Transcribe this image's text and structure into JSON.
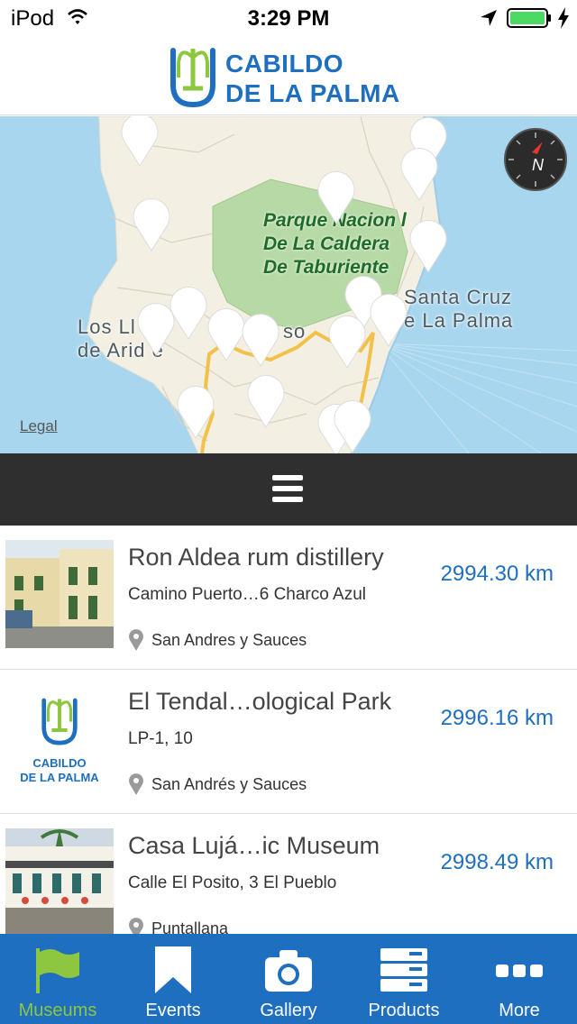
{
  "status_bar": {
    "carrier": "iPod",
    "time": "3:29 PM"
  },
  "header": {
    "brand_line1": "CABILDO",
    "brand_line2": "DE LA PALMA",
    "brand_color": "#1e6fbf",
    "brand_accent": "#8dc63f"
  },
  "map": {
    "park_label": "Parque Nacion  l\nDe La Caldera\nDe Taburiente",
    "town_labels": [
      {
        "id": "llanos",
        "text": "Los Ll\nde Arid    e"
      },
      {
        "id": "paso",
        "text": "so"
      },
      {
        "id": "santa_cruz",
        "text": "Santa Cruz\ne La Palma"
      }
    ],
    "legal": "Legal",
    "compass_letter": "N"
  },
  "list": {
    "items": [
      {
        "title": "Ron Aldea rum distillery",
        "address": "Camino Puerto…6 Charco Azul",
        "town": "San Andres y Sauces",
        "distance": "2994.30 km",
        "thumb": "photo"
      },
      {
        "title": "El Tendal…ological Park",
        "address": "LP-1, 10",
        "town": "San Andrés y Sauces",
        "distance": "2996.16 km",
        "thumb": "logo",
        "thumb_line1": "CABILDO",
        "thumb_line2": "DE LA PALMA"
      },
      {
        "title": "Casa Lujá…ic Museum",
        "address": "Calle El Posito, 3 El Pueblo",
        "town": "Puntallana",
        "distance": "2998.49 km",
        "thumb": "photo"
      }
    ]
  },
  "tab_bar": {
    "tabs": [
      {
        "label": "Museums",
        "icon": "flag-icon",
        "active": true
      },
      {
        "label": "Events",
        "icon": "bookmark-icon",
        "active": false
      },
      {
        "label": "Gallery",
        "icon": "camera-icon",
        "active": false
      },
      {
        "label": "Products",
        "icon": "products-icon",
        "active": false
      },
      {
        "label": "More",
        "icon": "more-icon",
        "active": false
      }
    ],
    "background": "#1e6fbf",
    "active_color": "#8dc63f"
  }
}
